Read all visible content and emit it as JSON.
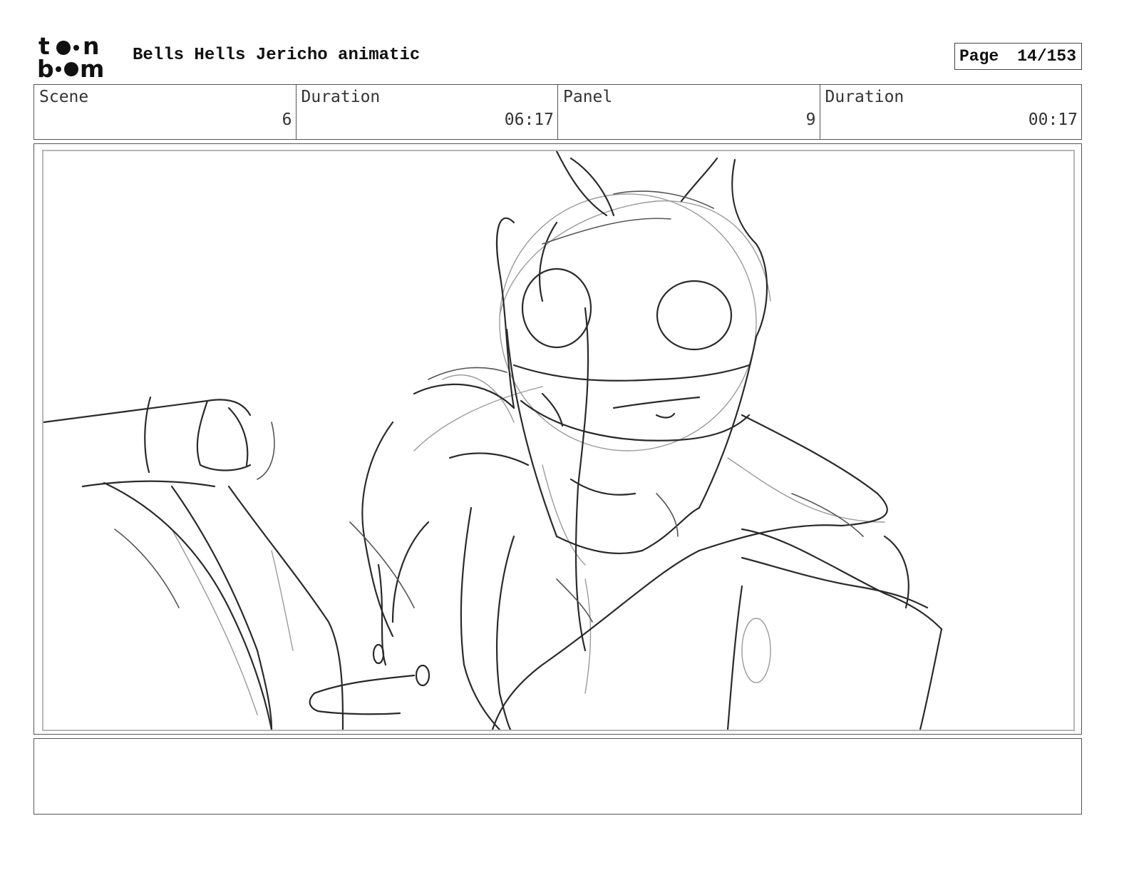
{
  "header": {
    "logo": {
      "line1": "toon",
      "line2": "boom"
    },
    "title": "Bells Hells Jericho animatic",
    "page_label": "Page",
    "page_value": "14/153"
  },
  "info": {
    "scene_label": "Scene",
    "scene_value": "6",
    "scene_duration_label": "Duration",
    "scene_duration_value": "06:17",
    "panel_label": "Panel",
    "panel_value": "9",
    "panel_duration_label": "Duration",
    "panel_duration_value": "00:17"
  },
  "panel_image": {
    "description_icon": "rough-sketch-image"
  },
  "notes": {
    "text": ""
  }
}
